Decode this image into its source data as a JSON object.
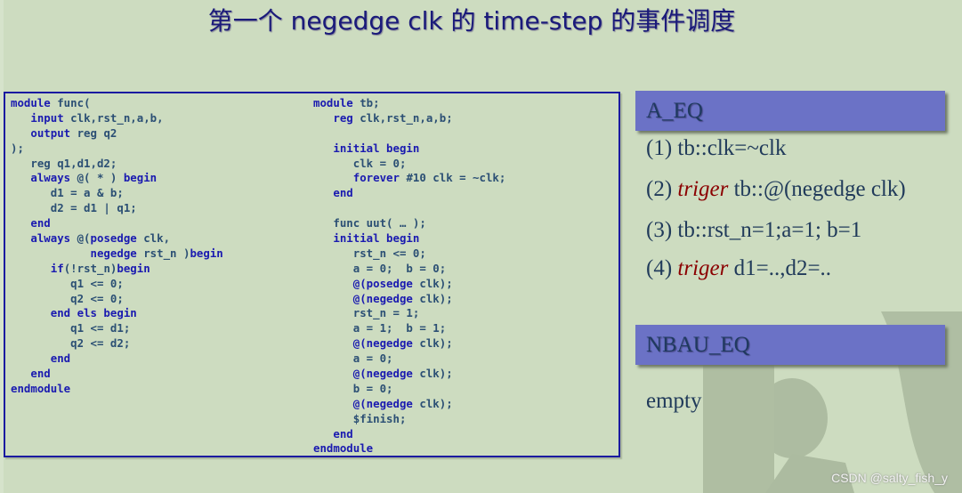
{
  "title": "第一个 negedge clk 的 time-step 的事件调度",
  "code": {
    "left_module": [
      [
        {
          "t": "module",
          "k": "kw"
        },
        {
          "t": " func(",
          "k": "id"
        }
      ],
      [
        {
          "t": "   input",
          "k": "kw"
        },
        {
          "t": " clk,rst_n,a,b,",
          "k": "id"
        }
      ],
      [
        {
          "t": "   output",
          "k": "kw"
        },
        {
          "t": " reg q2",
          "k": "id"
        }
      ],
      [
        {
          "t": ");",
          "k": "id"
        }
      ],
      [
        {
          "t": "   reg q1,d1,d2;",
          "k": "id"
        }
      ],
      [
        {
          "t": "   always",
          "k": "kw"
        },
        {
          "t": " @( * ) ",
          "k": "id"
        },
        {
          "t": "begin",
          "k": "kw"
        }
      ],
      [
        {
          "t": "      d1 = a & b;",
          "k": "id"
        }
      ],
      [
        {
          "t": "      d2 = d1 | q1;",
          "k": "id"
        }
      ],
      [
        {
          "t": "   end",
          "k": "kw"
        }
      ],
      [
        {
          "t": "   always",
          "k": "kw"
        },
        {
          "t": " @(",
          "k": "id"
        },
        {
          "t": "posedge",
          "k": "kw"
        },
        {
          "t": " clk,",
          "k": "id"
        }
      ],
      [
        {
          "t": "            negedge",
          "k": "kw"
        },
        {
          "t": " rst_n )",
          "k": "id"
        },
        {
          "t": "begin",
          "k": "kw"
        }
      ],
      [
        {
          "t": "      if",
          "k": "kw"
        },
        {
          "t": "(!rst_n)",
          "k": "id"
        },
        {
          "t": "begin",
          "k": "kw"
        }
      ],
      [
        {
          "t": "         q1 <= 0;",
          "k": "id"
        }
      ],
      [
        {
          "t": "         q2 <= 0;",
          "k": "id"
        }
      ],
      [
        {
          "t": "      end els begin",
          "k": "kw"
        }
      ],
      [
        {
          "t": "         q1 <= d1;",
          "k": "id"
        }
      ],
      [
        {
          "t": "         q2 <= d2;",
          "k": "id"
        }
      ],
      [
        {
          "t": "      end",
          "k": "kw"
        }
      ],
      [
        {
          "t": "   end",
          "k": "kw"
        }
      ],
      [
        {
          "t": "endmodule",
          "k": "kw"
        }
      ]
    ],
    "right_module": [
      [
        {
          "t": "module",
          "k": "kw"
        },
        {
          "t": " tb;",
          "k": "id"
        }
      ],
      [
        {
          "t": "   reg",
          "k": "kw"
        },
        {
          "t": " clk,rst_n,a,b;",
          "k": "id"
        }
      ],
      [
        {
          "t": "",
          "k": "id"
        }
      ],
      [
        {
          "t": "   initial begin",
          "k": "kw"
        }
      ],
      [
        {
          "t": "      clk = 0;",
          "k": "id"
        }
      ],
      [
        {
          "t": "      forever",
          "k": "kw"
        },
        {
          "t": " #10 clk = ~clk;",
          "k": "id"
        }
      ],
      [
        {
          "t": "   end",
          "k": "kw"
        }
      ],
      [
        {
          "t": "",
          "k": "id"
        }
      ],
      [
        {
          "t": "   func uut( … );",
          "k": "id"
        }
      ],
      [
        {
          "t": "   initial begin",
          "k": "kw"
        }
      ],
      [
        {
          "t": "      rst_n <= 0;",
          "k": "id"
        }
      ],
      [
        {
          "t": "      a = 0;  b = 0;",
          "k": "id"
        }
      ],
      [
        {
          "t": "      @(posedge",
          "k": "kw"
        },
        {
          "t": " clk);",
          "k": "id"
        }
      ],
      [
        {
          "t": "      @(negedge",
          "k": "kw"
        },
        {
          "t": " clk);",
          "k": "id"
        }
      ],
      [
        {
          "t": "      rst_n = 1;",
          "k": "id"
        }
      ],
      [
        {
          "t": "      a = 1;  b = 1;",
          "k": "id"
        }
      ],
      [
        {
          "t": "      @(negedge",
          "k": "kw"
        },
        {
          "t": " clk);",
          "k": "id"
        }
      ],
      [
        {
          "t": "      a = 0;",
          "k": "id"
        }
      ],
      [
        {
          "t": "      @(negedge",
          "k": "kw"
        },
        {
          "t": " clk);",
          "k": "id"
        }
      ],
      [
        {
          "t": "      b = 0;",
          "k": "id"
        }
      ],
      [
        {
          "t": "      @(negedge",
          "k": "kw"
        },
        {
          "t": " clk);",
          "k": "id"
        }
      ],
      [
        {
          "t": "      $finish;",
          "k": "id"
        }
      ],
      [
        {
          "t": "   end",
          "k": "kw"
        }
      ],
      [
        {
          "t": "endmodule",
          "k": "kw"
        }
      ]
    ]
  },
  "active_queue": {
    "header": "A_EQ",
    "items": [
      {
        "num": "(1)",
        "trigger": "",
        "text": "tb::clk=~clk"
      },
      {
        "num": "(2)",
        "trigger": "triger",
        "text": "tb::@(negedge clk)"
      },
      {
        "num": "(3)",
        "trigger": "",
        "text": "tb::rst_n=1;a=1; b=1"
      },
      {
        "num": "(4)",
        "trigger": "triger",
        "text": "d1=..,d2=.."
      }
    ]
  },
  "nba_queue": {
    "header": "NBAU_EQ",
    "content": "empty"
  },
  "watermark": "CSDN @salty_fish_y"
}
